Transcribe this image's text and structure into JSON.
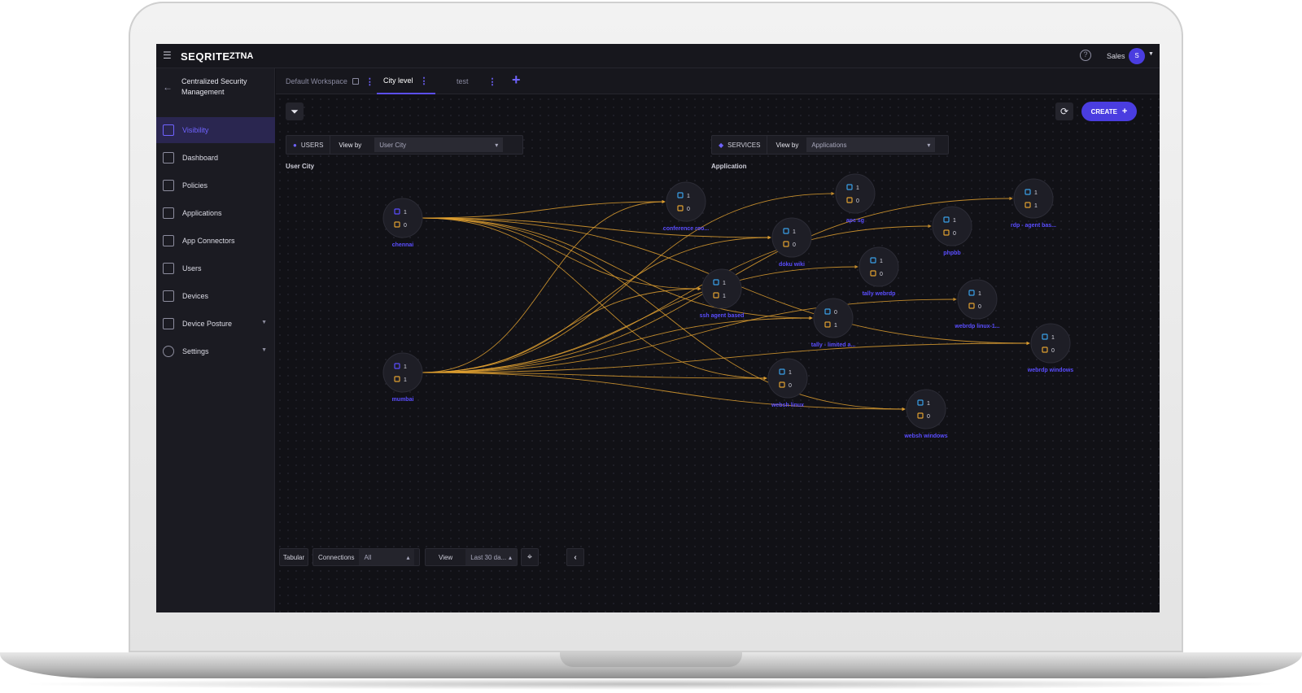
{
  "app": {
    "brand": "SEQRITE",
    "product": "ZTNA",
    "user_name": "Sales",
    "user_initial": "S"
  },
  "sidebar": {
    "section_title": "Centralized Security Management",
    "items": [
      {
        "label": "Visibility",
        "active": true
      },
      {
        "label": "Dashboard"
      },
      {
        "label": "Policies"
      },
      {
        "label": "Applications"
      },
      {
        "label": "App Connectors"
      },
      {
        "label": "Users"
      },
      {
        "label": "Devices"
      },
      {
        "label": "Device Posture",
        "has_children": true
      },
      {
        "label": "Settings",
        "has_children": true
      }
    ]
  },
  "tabs": [
    {
      "label": "Default Workspace",
      "locked": true
    },
    {
      "label": "City level",
      "active": true
    },
    {
      "label": "test"
    }
  ],
  "toolbar": {
    "create_label": "CREATE",
    "filter_icon": "filter-icon",
    "refresh_icon": "refresh-icon"
  },
  "users_panel": {
    "tag": "USERS",
    "view_by_label": "View by",
    "view_by_value": "User City",
    "column_heading": "User City"
  },
  "services_panel": {
    "tag": "SERVICES",
    "view_by_label": "View by",
    "view_by_value": "Applications",
    "column_heading": "Application"
  },
  "graph": {
    "edge_color": "#e0a030",
    "accent": "#5a4dff",
    "sources": [
      {
        "id": "chennai",
        "label": "chennai",
        "users": "1",
        "devices": "0"
      },
      {
        "id": "mumbai",
        "label": "mumbai",
        "users": "1",
        "devices": "1"
      }
    ],
    "targets": [
      {
        "id": "conf",
        "label": "conference roo...",
        "a": "1",
        "b": "0"
      },
      {
        "id": "apcsg",
        "label": "apc sg",
        "a": "1",
        "b": "0"
      },
      {
        "id": "rdp",
        "label": "rdp - agent bas...",
        "a": "1",
        "b": "1"
      },
      {
        "id": "phpbb",
        "label": "phpbb",
        "a": "1",
        "b": "0"
      },
      {
        "id": "doku",
        "label": "doku wiki",
        "a": "1",
        "b": "0"
      },
      {
        "id": "tallyweb",
        "label": "tally webrdp",
        "a": "1",
        "b": "0"
      },
      {
        "id": "ssh",
        "label": "ssh agent based",
        "a": "1",
        "b": "1"
      },
      {
        "id": "webrdplinux",
        "label": "webrdp linux-1...",
        "a": "1",
        "b": "0"
      },
      {
        "id": "tallylimited",
        "label": "tally - limited a...",
        "a": "0",
        "b": "1"
      },
      {
        "id": "webrdpwin",
        "label": "webrdp windows",
        "a": "1",
        "b": "0"
      },
      {
        "id": "webshlinux",
        "label": "websh linux",
        "a": "1",
        "b": "0"
      },
      {
        "id": "webshwin",
        "label": "websh windows",
        "a": "1",
        "b": "0"
      }
    ]
  },
  "bottom_bar": {
    "tabular_label": "Tabular",
    "connections_label": "Connections",
    "connections_value": "All",
    "view_label": "View",
    "view_value": "Last 30 da..."
  }
}
